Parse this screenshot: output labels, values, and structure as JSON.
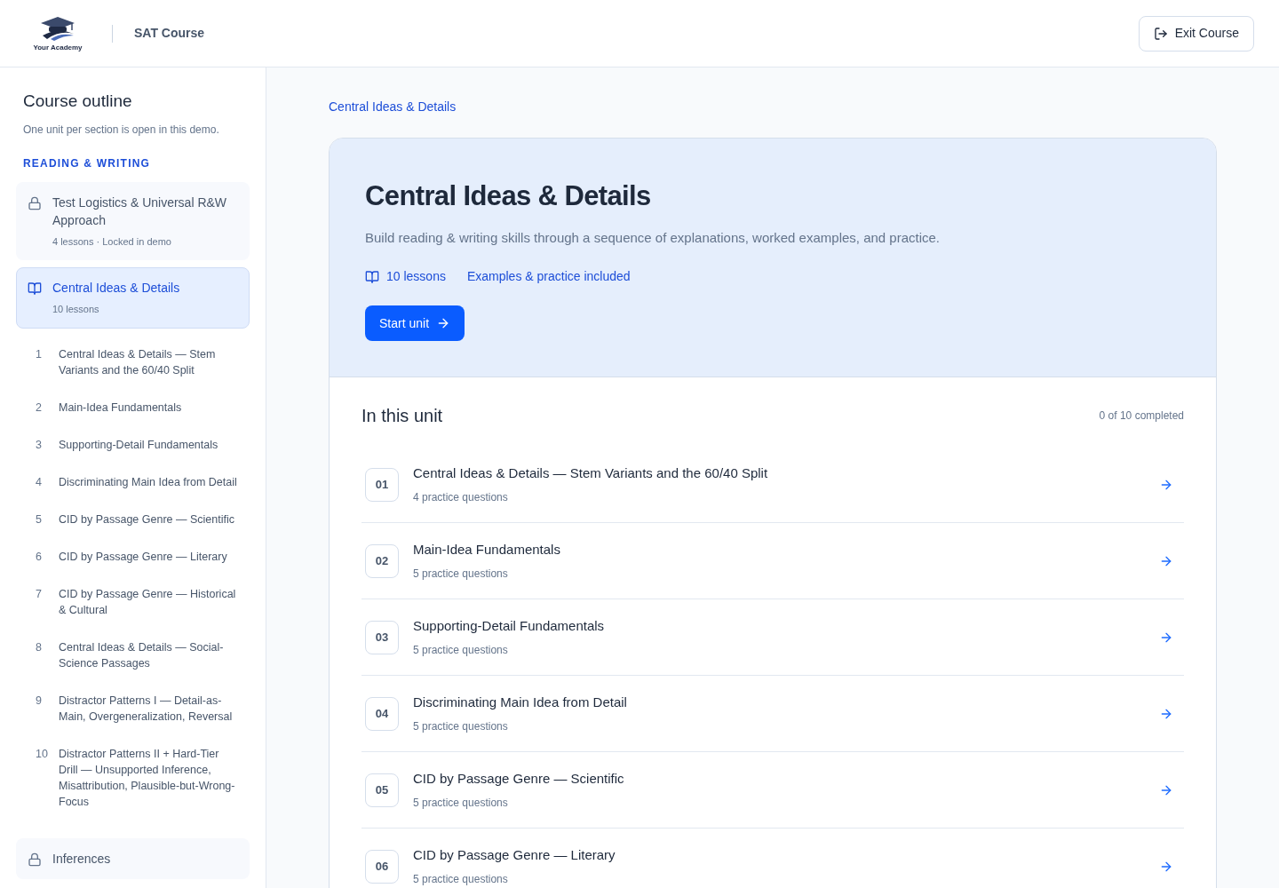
{
  "header": {
    "logo_text": "Your Academy",
    "course": "SAT Course",
    "exit_button": "Exit Course"
  },
  "sidebar": {
    "title": "Course outline",
    "note": "One unit per section is open in this demo.",
    "section_label": "READING & WRITING",
    "units": [
      {
        "title": "Test Logistics & Universal R&W Approach",
        "meta": "4 lessons · Locked in demo",
        "locked": true,
        "selected": false
      },
      {
        "title": "Central Ideas & Details",
        "meta": "10 lessons",
        "locked": false,
        "selected": true,
        "lessons": [
          {
            "number": "1",
            "title": "Central Ideas & Details — Stem Variants and the 60/40 Split"
          },
          {
            "number": "2",
            "title": "Main-Idea Fundamentals"
          },
          {
            "number": "3",
            "title": "Supporting-Detail Fundamentals"
          },
          {
            "number": "4",
            "title": "Discriminating Main Idea from Detail"
          },
          {
            "number": "5",
            "title": "CID by Passage Genre — Scientific"
          },
          {
            "number": "6",
            "title": "CID by Passage Genre — Literary"
          },
          {
            "number": "7",
            "title": "CID by Passage Genre — Historical & Cultural"
          },
          {
            "number": "8",
            "title": "Central Ideas & Details — Social-Science Passages"
          },
          {
            "number": "9",
            "title": "Distractor Patterns I — Detail-as-Main, Overgeneralization, Reversal"
          },
          {
            "number": "10",
            "title": "Distractor Patterns II + Hard-Tier Drill — Unsupported Inference, Misattribution, Plausible-but-Wrong-Focus"
          }
        ]
      },
      {
        "title": "Inferences",
        "locked": true,
        "selected": false
      }
    ]
  },
  "main": {
    "breadcrumb": "Central Ideas & Details",
    "hero": {
      "title": "Central Ideas & Details",
      "description": "Build reading & writing skills through a sequence of explanations, worked examples, and practice.",
      "lessons_count": "10 lessons",
      "extras": "Examples & practice included",
      "button": "Start unit"
    },
    "unit_list": {
      "title": "In this unit",
      "progress": "0 of 10 completed",
      "items": [
        {
          "number": "01",
          "title": "Central Ideas & Details — Stem Variants and the 60/40 Split",
          "meta": "4 practice questions"
        },
        {
          "number": "02",
          "title": "Main-Idea Fundamentals",
          "meta": "5 practice questions"
        },
        {
          "number": "03",
          "title": "Supporting-Detail Fundamentals",
          "meta": "5 practice questions"
        },
        {
          "number": "04",
          "title": "Discriminating Main Idea from Detail",
          "meta": "5 practice questions"
        },
        {
          "number": "05",
          "title": "CID by Passage Genre — Scientific",
          "meta": "5 practice questions"
        },
        {
          "number": "06",
          "title": "CID by Passage Genre — Literary",
          "meta": "5 practice questions"
        }
      ]
    }
  }
}
